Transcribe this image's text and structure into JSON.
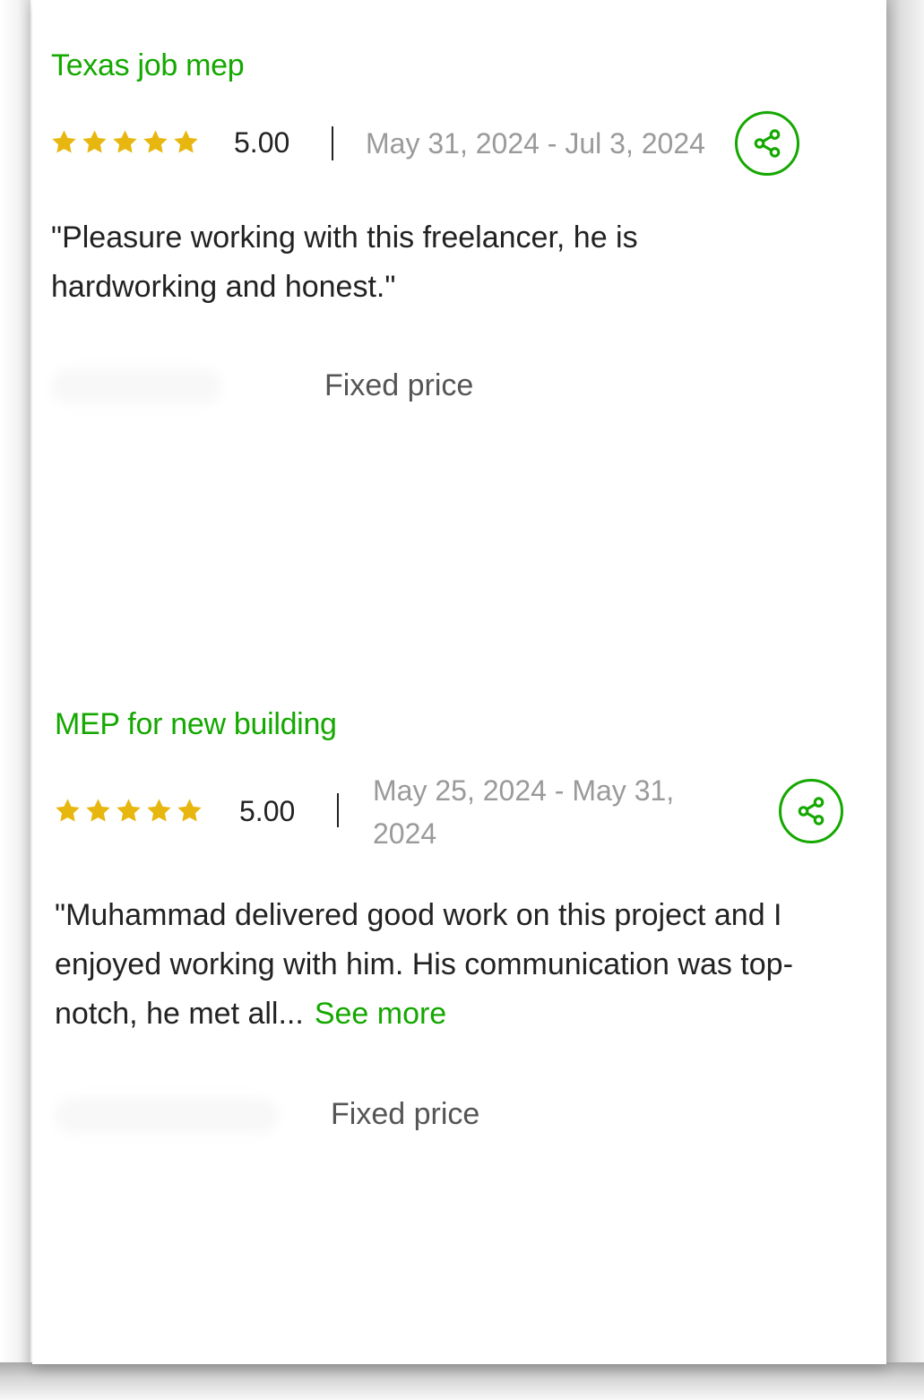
{
  "reviews": [
    {
      "title": "Texas job mep",
      "stars": 5,
      "rating": "5.00",
      "dates": "May 31, 2024 - Jul 3, 2024",
      "comment": "\"Pleasure working with this freelancer, he is hardworking and honest.\"",
      "see_more": "",
      "contract_type": "Fixed price"
    },
    {
      "title": "MEP for new building",
      "stars": 5,
      "rating": "5.00",
      "dates": "May 25, 2024 - May 31, 2024",
      "comment": "\"Muhammad delivered good work on this project and I enjoyed working with him. His communication was top-notch, he met all...",
      "see_more": "See more",
      "contract_type": "Fixed price"
    }
  ],
  "colors": {
    "accent": "#14a800",
    "star": "#e8b70f",
    "text": "#222222",
    "muted": "#9a9a9a"
  },
  "icons": {
    "star": "star-icon",
    "share": "share-icon"
  }
}
